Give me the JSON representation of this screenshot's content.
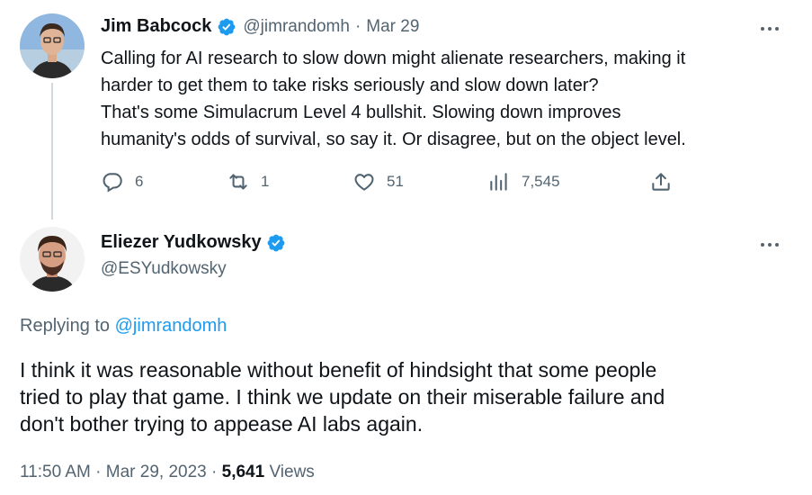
{
  "parent_tweet": {
    "author_name": "Jim Babcock",
    "handle": "@jimrandomh",
    "separator": "·",
    "date": "Mar 29",
    "text_lines": [
      "Calling for AI research to slow down might alienate researchers, making it",
      "harder to get them to take risks seriously and slow down later?",
      "That's some Simulacrum Level 4 bullshit. Slowing down improves",
      "humanity's odds of survival, so say it. Or disagree, but on the object level."
    ],
    "actions": {
      "replies": "6",
      "retweets": "1",
      "likes": "51",
      "views": "7,545"
    }
  },
  "main_tweet": {
    "author_name": "Eliezer Yudkowsky",
    "handle": "@ESYudkowsky",
    "replying_prefix": "Replying to",
    "replying_handle": "@jimrandomh",
    "text_lines": [
      "I think it was reasonable without benefit of hindsight that some people",
      "tried to play that game.  I think we update on their miserable failure and",
      "don't bother trying to appease AI labs again."
    ],
    "time": "11:50 AM",
    "separator": "·",
    "date": "Mar 29, 2023",
    "separator2": "·",
    "views_count": "5,641",
    "views_label": "Views"
  },
  "colors": {
    "verified_badge": "#1d9bf0",
    "link": "#1d9bf0",
    "secondary_text": "#536471",
    "primary_text": "#0f1419"
  },
  "icons": [
    "verified-badge-icon",
    "more-icon",
    "reply-icon",
    "retweet-icon",
    "like-icon",
    "views-icon",
    "share-icon"
  ]
}
